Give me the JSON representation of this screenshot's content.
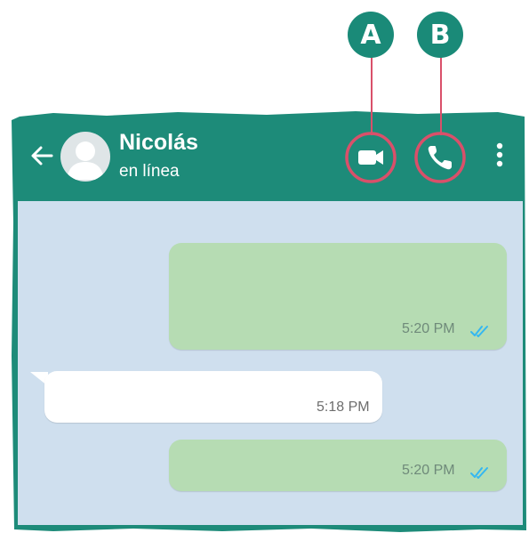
{
  "callouts": {
    "a_label": "A",
    "b_label": "B"
  },
  "header": {
    "contact_name": "Nicolás",
    "status": "en línea",
    "back_icon": "arrow-left-icon",
    "avatar_icon": "person-icon",
    "video_icon": "video-camera-icon",
    "call_icon": "phone-icon",
    "menu_icon": "more-vertical-icon"
  },
  "messages": [
    {
      "direction": "outgoing",
      "text": "",
      "time": "5:20 PM",
      "status": "read"
    },
    {
      "direction": "incoming",
      "text": "",
      "time": "5:18 PM"
    },
    {
      "direction": "outgoing",
      "text": "",
      "time": "5:20 PM",
      "status": "read"
    }
  ],
  "colors": {
    "header": "#1d8b79",
    "marker": "#1a8a78",
    "highlight": "#d9506a",
    "chat_background": "#cfdfee",
    "outgoing_bubble": "#b6dcb3",
    "incoming_bubble": "#ffffff",
    "read_ticks": "#34b7f1"
  }
}
